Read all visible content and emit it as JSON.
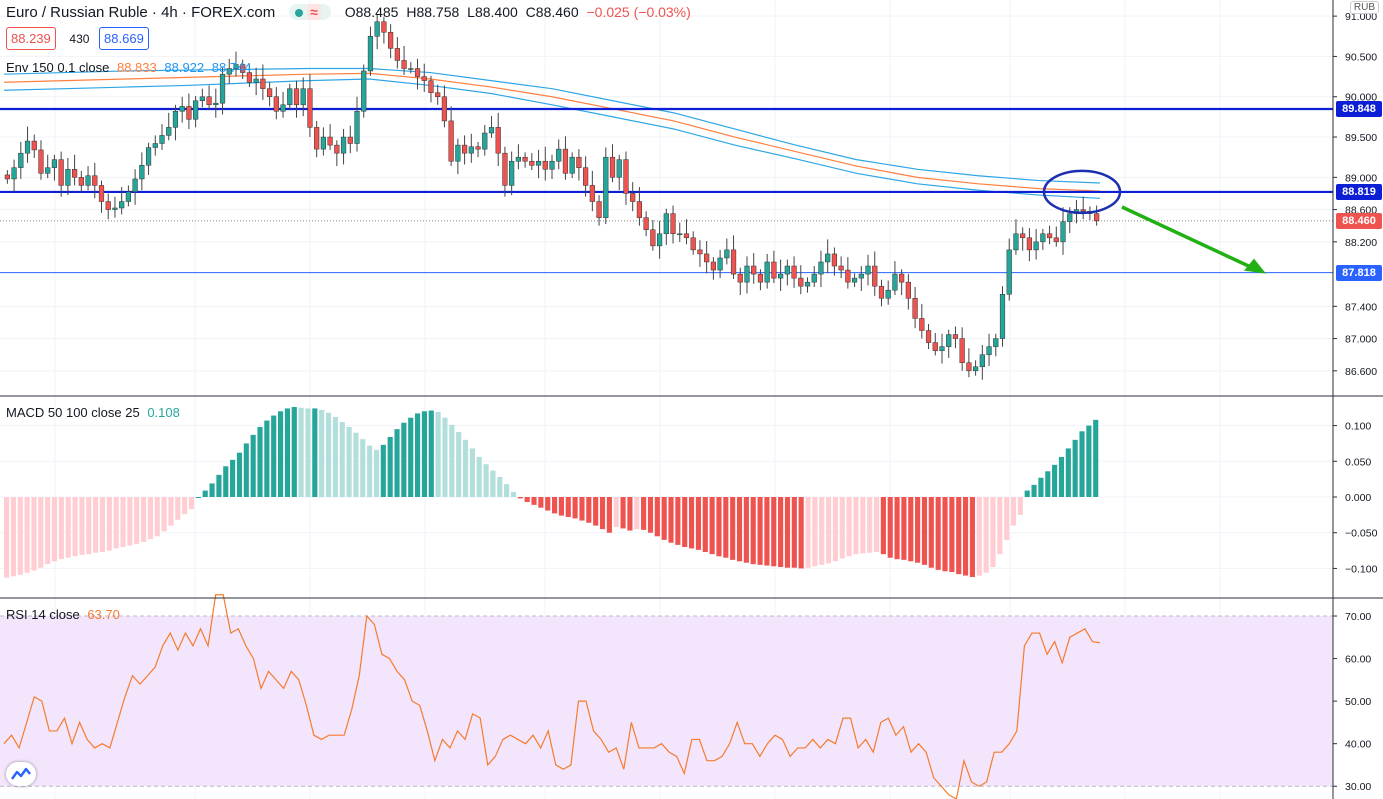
{
  "header": {
    "title": "Euro / Russian Ruble · 4h · FOREX.com",
    "ohlc": {
      "o": "O88.485",
      "h": "H88.758",
      "l": "L88.400",
      "c": "C88.460",
      "chg": "−0.025 (−0.03%)"
    },
    "bid": "88.239",
    "spread": "430",
    "ask": "88.669",
    "unit": "RUB"
  },
  "indicators": {
    "env": {
      "label": "Env 150 0.1 close",
      "v1": "88.833",
      "v2": "88.922",
      "v3": "88.744"
    },
    "macd": {
      "label": "MACD 50 100 close 25",
      "value": "0.108"
    },
    "rsi": {
      "label": "RSI 14 close",
      "value": "63.70"
    }
  },
  "colors": {
    "up": "#26a69a",
    "down": "#ef5350",
    "line_blue": "#0d1fd6",
    "line_light": "#2962ff",
    "env_orange": "#ff7f3f",
    "env_blue": "#2ea6e6",
    "arrow": "#22b014",
    "macd_up_strong": "#26a69a",
    "macd_up_weak": "#b2dfdb",
    "macd_dn_strong": "#ef5350",
    "macd_dn_weak": "#ffcdd2",
    "rsi_line": "#f57c2f",
    "rsi_band": "#f3e5fb"
  },
  "chart_data": [
    {
      "type": "candlestick",
      "title": "Euro / Russian Ruble · 4h · FOREX.com",
      "ylabel": "RUB",
      "ylim": [
        86.3,
        91.2
      ],
      "y_ticks": [
        "91.000",
        "90.500",
        "90.000",
        "89.500",
        "89.000",
        "88.600",
        "88.200",
        "87.400",
        "87.000",
        "86.600"
      ],
      "levels": [
        {
          "name": "resistance-high",
          "value": 89.848,
          "label": "89.848",
          "style": "thick"
        },
        {
          "name": "resistance",
          "value": 88.819,
          "label": "88.819",
          "style": "thick"
        },
        {
          "name": "support",
          "value": 87.818,
          "label": "87.818",
          "style": "thin"
        }
      ],
      "last_price": {
        "value": 88.46,
        "label": "88.460"
      },
      "close": [
        88.98,
        89.12,
        89.3,
        89.45,
        89.34,
        89.05,
        89.12,
        89.22,
        88.9,
        89.1,
        89.0,
        88.9,
        89.02,
        88.9,
        88.7,
        88.6,
        88.62,
        88.7,
        88.82,
        88.98,
        89.15,
        89.37,
        89.42,
        89.52,
        89.62,
        89.82,
        89.88,
        89.72,
        89.95,
        90.0,
        89.9,
        89.92,
        90.28,
        90.35,
        90.4,
        90.3,
        90.18,
        90.22,
        90.1,
        90.0,
        89.82,
        89.9,
        90.1,
        89.9,
        90.1,
        89.62,
        89.35,
        89.5,
        89.4,
        89.3,
        89.5,
        89.42,
        89.82,
        90.32,
        90.75,
        90.93,
        90.8,
        90.6,
        90.45,
        90.35,
        90.35,
        90.25,
        90.2,
        90.05,
        90.0,
        89.7,
        89.2,
        89.4,
        89.3,
        89.38,
        89.35,
        89.55,
        89.62,
        89.3,
        88.9,
        89.2,
        89.25,
        89.2,
        89.15,
        89.2,
        89.1,
        89.2,
        89.35,
        89.05,
        89.25,
        89.12,
        88.9,
        88.7,
        88.5,
        89.25,
        89.0,
        89.22,
        88.8,
        88.7,
        88.5,
        88.35,
        88.15,
        88.3,
        88.55,
        88.3,
        88.3,
        88.25,
        88.1,
        88.05,
        87.95,
        87.85,
        88.0,
        88.1,
        87.8,
        87.7,
        87.9,
        87.8,
        87.7,
        87.95,
        87.75,
        87.8,
        87.9,
        87.75,
        87.65,
        87.7,
        87.8,
        87.95,
        88.05,
        87.9,
        87.85,
        87.7,
        87.75,
        87.8,
        87.9,
        87.65,
        87.5,
        87.6,
        87.8,
        87.7,
        87.5,
        87.25,
        87.1,
        86.95,
        86.85,
        86.9,
        87.05,
        87.0,
        86.7,
        86.6,
        86.65,
        86.8,
        86.9,
        87.0,
        87.55,
        88.1,
        88.3,
        88.25,
        88.1,
        88.2,
        88.3,
        88.25,
        88.2,
        88.45,
        88.55,
        88.6,
        88.58,
        88.55,
        88.46
      ],
      "highs": {
        "max": 91.02,
        "max_index": 55
      },
      "envelope": {
        "upper": [
          90.28,
          90.3,
          90.32,
          90.33,
          90.34,
          90.35,
          90.35,
          90.3,
          90.2,
          90.1,
          89.95,
          89.8,
          89.6,
          89.4,
          89.22,
          89.1,
          89.02,
          88.96,
          88.93
        ],
        "basis": [
          90.18,
          90.2,
          90.22,
          90.24,
          90.26,
          90.28,
          90.29,
          90.22,
          90.12,
          90.0,
          89.85,
          89.7,
          89.5,
          89.32,
          89.14,
          89.0,
          88.92,
          88.86,
          88.83
        ],
        "lower": [
          90.08,
          90.1,
          90.12,
          90.14,
          90.17,
          90.2,
          90.22,
          90.14,
          90.04,
          89.9,
          89.75,
          89.6,
          89.4,
          89.23,
          89.05,
          88.92,
          88.84,
          88.78,
          88.74
        ]
      },
      "annotations": [
        {
          "type": "ellipse",
          "around_price": 88.82
        },
        {
          "type": "arrow",
          "direction": "down",
          "target_price": 87.818
        }
      ]
    },
    {
      "type": "bar",
      "title": "MACD 50 100 close 25",
      "ylim": [
        -0.14,
        0.14
      ],
      "y_ticks": [
        "0.100",
        "0.050",
        "0.000",
        "−0.050",
        "−0.100"
      ],
      "values": [
        -0.113,
        -0.111,
        -0.109,
        -0.106,
        -0.103,
        -0.099,
        -0.094,
        -0.09,
        -0.087,
        -0.085,
        -0.083,
        -0.081,
        -0.08,
        -0.078,
        -0.077,
        -0.075,
        -0.072,
        -0.07,
        -0.068,
        -0.066,
        -0.063,
        -0.059,
        -0.055,
        -0.048,
        -0.04,
        -0.032,
        -0.024,
        -0.017,
        0.0,
        0.009,
        0.019,
        0.031,
        0.043,
        0.052,
        0.062,
        0.075,
        0.087,
        0.098,
        0.107,
        0.114,
        0.12,
        0.124,
        0.126,
        0.125,
        0.124,
        0.124,
        0.122,
        0.118,
        0.112,
        0.105,
        0.098,
        0.09,
        0.081,
        0.072,
        0.066,
        0.073,
        0.084,
        0.095,
        0.104,
        0.111,
        0.117,
        0.12,
        0.121,
        0.119,
        0.111,
        0.101,
        0.091,
        0.08,
        0.068,
        0.056,
        0.046,
        0.037,
        0.028,
        0.018,
        0.007,
        -0.002,
        -0.007,
        -0.011,
        -0.015,
        -0.019,
        -0.023,
        -0.026,
        -0.028,
        -0.03,
        -0.033,
        -0.036,
        -0.04,
        -0.045,
        -0.05,
        -0.042,
        -0.044,
        -0.047,
        -0.045,
        -0.046,
        -0.05,
        -0.055,
        -0.06,
        -0.064,
        -0.067,
        -0.07,
        -0.072,
        -0.074,
        -0.077,
        -0.08,
        -0.083,
        -0.085,
        -0.088,
        -0.09,
        -0.092,
        -0.094,
        -0.095,
        -0.096,
        -0.097,
        -0.098,
        -0.099,
        -0.099,
        -0.1,
        -0.099,
        -0.097,
        -0.095,
        -0.093,
        -0.09,
        -0.086,
        -0.083,
        -0.08,
        -0.079,
        -0.078,
        -0.077,
        -0.08,
        -0.085,
        -0.087,
        -0.088,
        -0.09,
        -0.092,
        -0.095,
        -0.099,
        -0.102,
        -0.104,
        -0.105,
        -0.108,
        -0.11,
        -0.112,
        -0.11,
        -0.106,
        -0.098,
        -0.08,
        -0.06,
        -0.04,
        -0.025,
        0.009,
        0.017,
        0.027,
        0.036,
        0.045,
        0.056,
        0.068,
        0.08,
        0.092,
        0.1,
        0.108
      ]
    },
    {
      "type": "line",
      "title": "RSI 14 close",
      "ylim": [
        27,
        74
      ],
      "y_ticks": [
        "70.00",
        "60.00",
        "50.00",
        "40.00",
        "30.00"
      ],
      "band": [
        30,
        70
      ],
      "values": [
        40,
        42,
        39,
        45,
        51,
        50,
        43,
        43,
        46,
        40,
        45,
        41,
        39,
        40,
        39,
        45,
        51,
        56,
        54,
        56,
        58,
        63,
        66,
        62,
        66,
        63,
        67,
        63,
        75,
        75,
        66,
        67,
        63,
        60,
        53,
        57,
        55,
        53,
        57,
        55,
        49,
        42,
        41,
        42,
        42,
        42,
        48,
        56,
        70,
        68,
        61,
        60,
        57,
        55,
        50,
        49,
        43,
        36,
        41,
        39,
        43,
        41,
        47,
        46,
        35,
        37,
        41,
        42,
        41,
        40,
        42,
        39,
        43,
        35,
        34,
        35,
        50,
        50,
        43,
        41,
        38,
        39,
        34,
        45,
        39,
        39,
        39,
        40,
        38,
        37,
        33,
        41,
        41,
        36,
        36,
        37,
        40,
        45,
        40,
        40,
        37,
        40,
        42,
        41,
        37,
        39,
        39,
        41,
        39,
        41,
        40,
        46,
        46,
        39,
        41,
        38,
        45,
        46,
        42,
        44,
        38,
        40,
        38,
        32,
        30,
        28,
        27,
        36,
        31,
        30,
        31,
        38,
        38,
        40,
        43,
        63,
        66,
        66,
        61,
        64,
        59,
        65,
        66,
        67,
        64,
        63.7
      ]
    }
  ]
}
